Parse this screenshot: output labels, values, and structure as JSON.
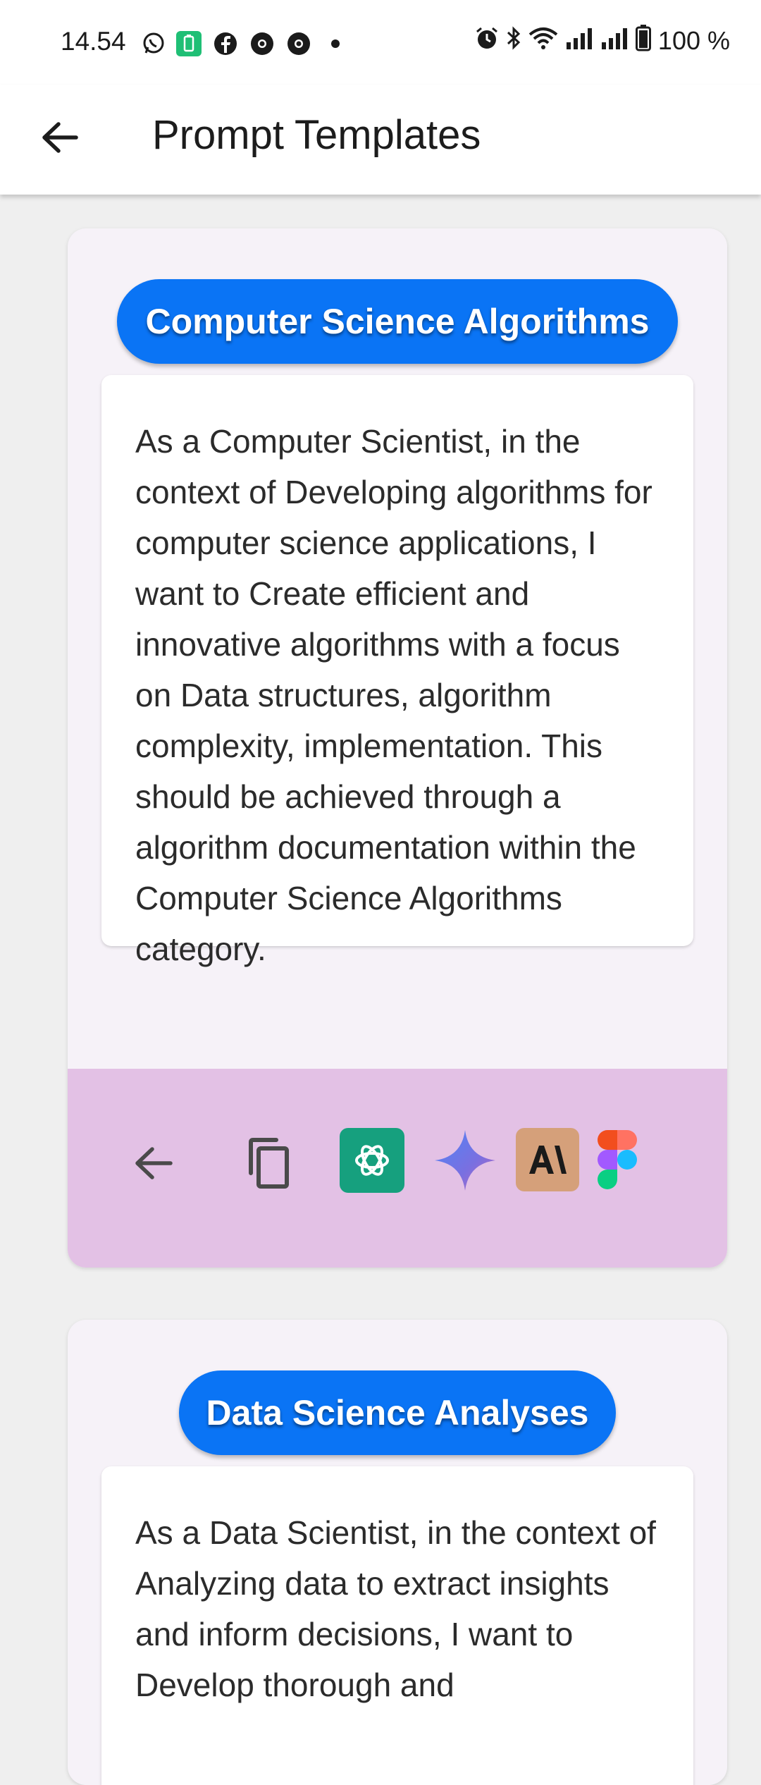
{
  "status_bar": {
    "time": "14.54",
    "notification_icons": [
      "whatsapp-icon",
      "battery-saver-icon",
      "facebook-icon",
      "chrome-icon",
      "chrome-icon",
      "more-dot-icon"
    ],
    "system_icons": [
      "alarm-icon",
      "bluetooth-icon",
      "wifi-icon",
      "signal-icon",
      "signal-icon",
      "battery-icon"
    ],
    "battery": "100 %"
  },
  "app_bar": {
    "back_icon": "arrow-back-icon",
    "title": "Prompt Templates"
  },
  "cards": [
    {
      "category": "Computer Science Algorithms",
      "prompt": "As a Computer Scientist, in the context of Developing algorithms for computer science applications, I want to Create efficient and innovative algorithms with a focus on Data structures, algorithm complexity, implementation. This should be achieved through a algorithm documentation within the Computer Science Algorithms category.",
      "actions": [
        "arrow-back-icon",
        "copy-icon",
        "chatgpt-icon",
        "gemini-icon",
        "anthropic-icon",
        "figma-icon"
      ]
    },
    {
      "category": "Data Science Analyses",
      "prompt": "As a Data Scientist, in the context of Analyzing data to extract insights and inform decisions, I want to Develop thorough and"
    }
  ],
  "colors": {
    "pill": "#0a74f5",
    "action_bar": "#e3c1e5",
    "chatgpt": "#16a07e",
    "anthropic": "#d5a07a"
  }
}
